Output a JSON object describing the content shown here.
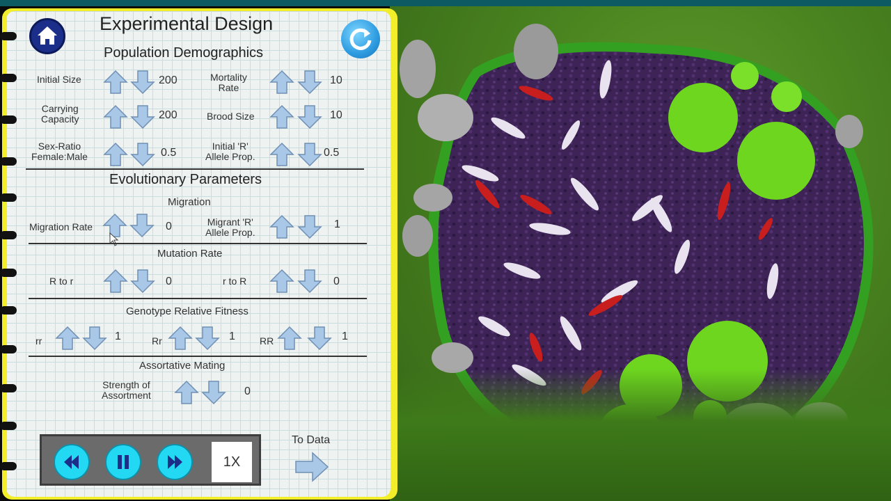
{
  "panel": {
    "title": "Experimental Design",
    "population": {
      "heading": "Population Demographics",
      "initial_size": {
        "label": "Initial Size",
        "value": "200"
      },
      "mortality_rate": {
        "label1": "Mortality",
        "label2": "Rate",
        "value": "10"
      },
      "carrying_capacity": {
        "label1": "Carrying",
        "label2": "Capacity",
        "value": "200"
      },
      "brood_size": {
        "label": "Brood Size",
        "value": "10"
      },
      "sex_ratio": {
        "label1": "Sex-Ratio",
        "label2": "Female:Male",
        "value": "0.5"
      },
      "initial_r_allele": {
        "label1": "Initial 'R'",
        "label2": "Allele Prop.",
        "value": "0.5"
      }
    },
    "evolution": {
      "heading": "Evolutionary Parameters",
      "migration_heading": "Migration",
      "migration_rate": {
        "label": "Migration Rate",
        "value": "0"
      },
      "migrant_r_allele": {
        "label1": "Migrant 'R'",
        "label2": "Allele Prop.",
        "value": "1"
      },
      "mutation_heading": "Mutation Rate",
      "r_to_R": {
        "label": "R to r",
        "value": "0"
      },
      "R_to_r": {
        "label": "r to R",
        "value": "0"
      },
      "fitness_heading": "Genotype Relative Fitness",
      "fitness_rr": {
        "label": "rr",
        "value": "1"
      },
      "fitness_Rr": {
        "label": "Rr",
        "value": "1"
      },
      "fitness_RR": {
        "label": "RR",
        "value": "1"
      },
      "mating_heading": "Assortative Mating",
      "assortment": {
        "label1": "Strength of",
        "label2": "Assortment",
        "value": "0"
      }
    },
    "controls": {
      "speed": "1X",
      "to_data": "To Data"
    }
  },
  "colors": {
    "accent": "#22d8f2",
    "frame": "#f2ee2a",
    "arrow": "#a9c8e8"
  }
}
